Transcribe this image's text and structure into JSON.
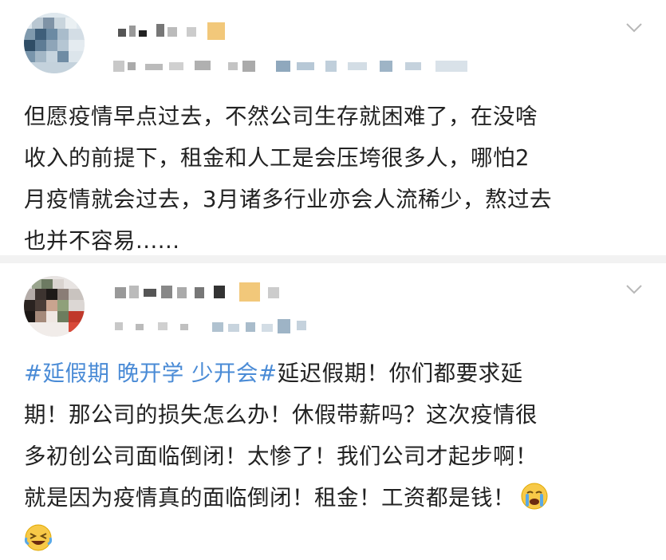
{
  "posts": [
    {
      "author": {
        "name_obscured": true,
        "meta_obscured": true,
        "avatar": "pixelated-avatar"
      },
      "menu_icon": "chevron-down-icon",
      "text": "但愿疫情早点过去，不然公司生存就困难了，在没啥\n收入的前提下，租金和人工是会压垮很多人，哪怕2\n月疫情就会过去，3月诸多行业亦会人流稀少，熬过去\n也并不容易......"
    },
    {
      "author": {
        "name_obscured": true,
        "meta_obscured": true,
        "avatar": "pixelated-avatar"
      },
      "menu_icon": "chevron-down-icon",
      "hashtag": "#延假期 晚开学 少开会#",
      "text_after_hashtag": "延迟假期！你们都要求延\n期！那公司的损失怎么办！休假带薪吗？这次疫情很\n多初创公司面临倒闭！太惨了！我们公司才起步啊！\n就是因为疫情真的面临倒闭！租金！工资都是钱！",
      "emojis": [
        "crying-face-emoji",
        "crying-laughing-face-emoji"
      ]
    }
  ],
  "colors": {
    "hashtag": "#4a8bd6",
    "text": "#222222",
    "separator": "#f2f2f2",
    "chevron": "#b8b8b8"
  }
}
